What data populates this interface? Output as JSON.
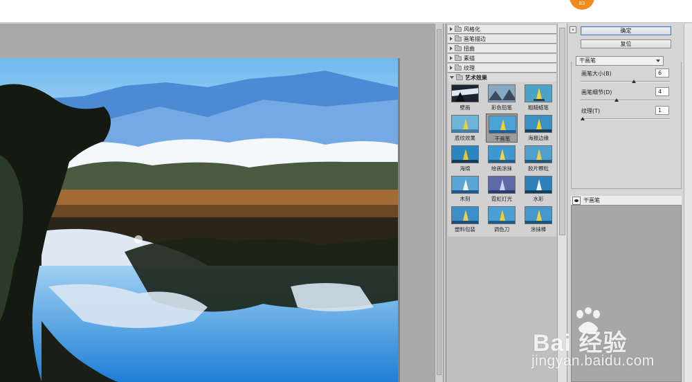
{
  "topbar": {
    "badge": "83"
  },
  "gallery": {
    "categories": [
      {
        "label": "风格化"
      },
      {
        "label": "画笔描边"
      },
      {
        "label": "扭曲"
      },
      {
        "label": "素描"
      },
      {
        "label": "纹理"
      },
      {
        "label": "艺术效果"
      }
    ],
    "tiles": [
      {
        "label": "壁画"
      },
      {
        "label": "彩色铅笔"
      },
      {
        "label": "粗糙蜡笔"
      },
      {
        "label": "底纹效果"
      },
      {
        "label": "干画笔"
      },
      {
        "label": "海报边缘"
      },
      {
        "label": "海绵"
      },
      {
        "label": "绘画涂抹"
      },
      {
        "label": "胶片颗粒"
      },
      {
        "label": "木刻"
      },
      {
        "label": "霓虹灯光"
      },
      {
        "label": "水彩"
      },
      {
        "label": "塑料包装"
      },
      {
        "label": "调色刀"
      },
      {
        "label": "涂抹棒"
      }
    ],
    "selected_tile": "干画笔"
  },
  "settings": {
    "ok_label": "确定",
    "reset_label": "复位",
    "filter_select": "干画笔",
    "params": [
      {
        "label": "画笔大小(B)",
        "value": "6",
        "fraction": 0.6
      },
      {
        "label": "画笔细节(D)",
        "value": "4",
        "fraction": 0.4
      },
      {
        "label": "纹理(T)",
        "value": "1",
        "fraction": 0.0
      }
    ],
    "layer_name": "干画笔"
  },
  "watermark": {
    "brand": "Bai 经验",
    "url": "jingyan.baidu.com"
  }
}
